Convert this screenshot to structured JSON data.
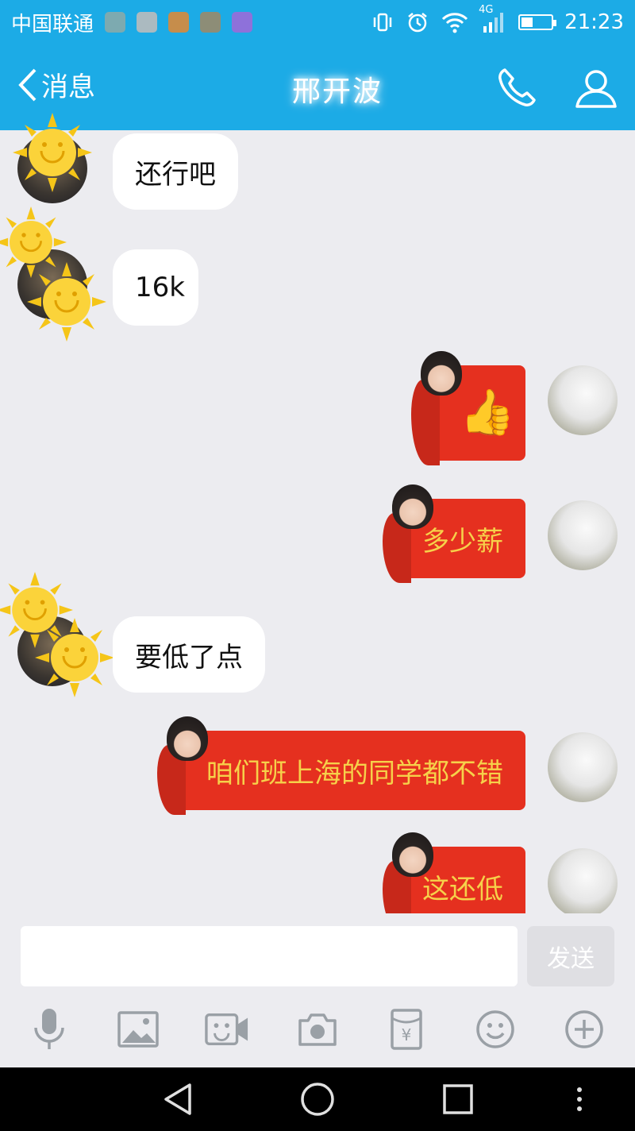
{
  "status_bar": {
    "carrier": "中国联通",
    "network": "4G",
    "time": "21:23",
    "battery_level": 0.35
  },
  "header": {
    "back_label": "消息",
    "chat_title": "邢开波"
  },
  "messages": [
    {
      "side": "incoming",
      "text": "还行吧"
    },
    {
      "side": "incoming",
      "text": "16k"
    },
    {
      "side": "outgoing",
      "emoji": "👍",
      "text": ""
    },
    {
      "side": "outgoing",
      "text": "多少薪"
    },
    {
      "side": "incoming",
      "text": "要低了点"
    },
    {
      "side": "outgoing",
      "text": "咱们班上海的同学都不错"
    },
    {
      "side": "outgoing",
      "text": "这还低"
    }
  ],
  "composer": {
    "input_value": "",
    "send_label": "发送"
  },
  "colors": {
    "header_blue": "#1cabe6",
    "bubble_red": "#e5301f",
    "bubble_text_yellow": "#f6d14a",
    "chat_bg": "#ececf0"
  }
}
